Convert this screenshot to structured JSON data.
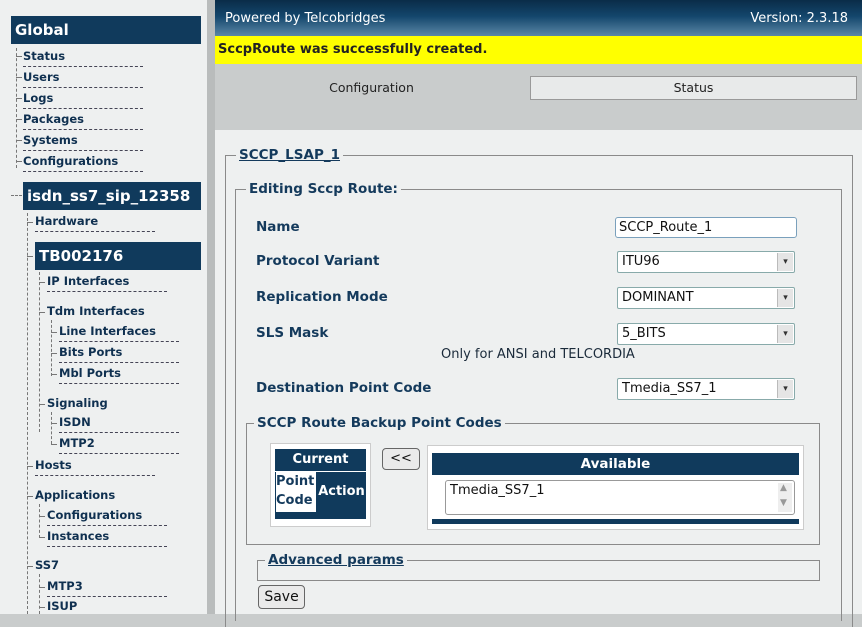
{
  "header": {
    "powered_by": "Powered by Telcobridges",
    "version": "Version: 2.3.18"
  },
  "banner": {
    "message": "SccpRoute was successfully created."
  },
  "tabs": [
    {
      "label": "Configuration",
      "active": true
    },
    {
      "label": "Status",
      "active": false
    }
  ],
  "sidebar": {
    "global_title": "Global",
    "global_items": [
      "Status",
      "Users",
      "Logs",
      "Packages",
      "Systems",
      "Configurations"
    ],
    "system_title": "isdn_ss7_sip_12358",
    "hardware": "Hardware",
    "device_title": "TB002176",
    "ip_interfaces": "IP Interfaces",
    "tdm_interfaces": "Tdm Interfaces",
    "line_interfaces": "Line Interfaces",
    "bits_ports": "Bits Ports",
    "mbl_ports": "Mbl Ports",
    "signaling": "Signaling",
    "isdn": "ISDN",
    "mtp2": "MTP2",
    "hosts": "Hosts",
    "applications": "Applications",
    "app_configurations": "Configurations",
    "instances": "Instances",
    "ss7": "SS7",
    "mtp3": "MTP3",
    "isup": "ISUP"
  },
  "form": {
    "outer_legend": "SCCP_LSAP_1",
    "editing_legend": "Editing Sccp Route:",
    "name_label": "Name",
    "name_value": "SCCP_Route_1",
    "protocol_label": "Protocol Variant",
    "protocol_value": "ITU96",
    "replication_label": "Replication Mode",
    "replication_value": "DOMINANT",
    "sls_label": "SLS Mask",
    "sls_value": "5_BITS",
    "sls_note": "Only for ANSI and TELCORDIA",
    "dpc_label": "Destination Point Code",
    "dpc_value": "Tmedia_SS7_1",
    "backup_legend": "SCCP Route Backup Point Codes",
    "current_header": "Current",
    "col_point_code": "Point Code",
    "col_action": "Action",
    "move_button": "<<",
    "available_header": "Available",
    "available_items": [
      "Tmedia_SS7_1"
    ],
    "advanced_legend": "Advanced params",
    "save_button": "Save"
  }
}
